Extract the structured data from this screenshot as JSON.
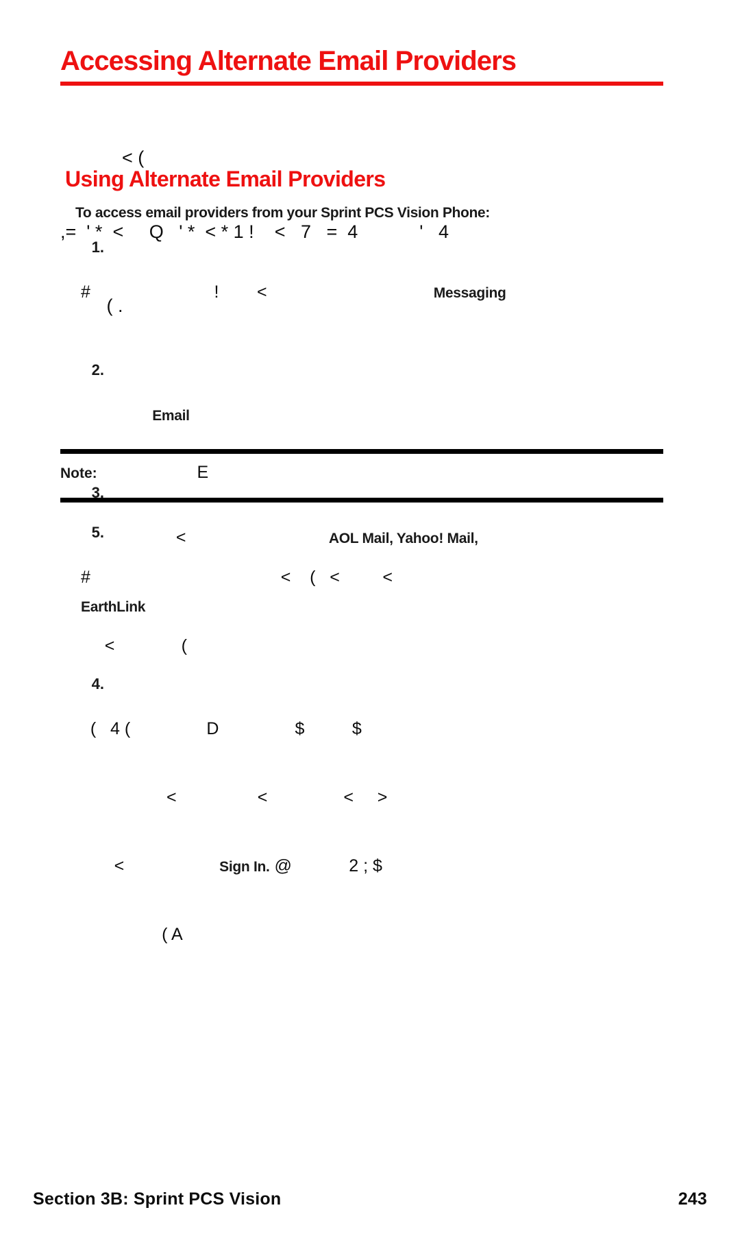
{
  "document": {
    "title": "Accessing Alternate Email Providers",
    "accent_color": "#ee1111",
    "text_color": "#0d0d0d",
    "page_background": "#ffffff"
  },
  "intro_paragraph": {
    "line1": "            < (",
    "line2": ",=  ' *  <     Q   ' *  < * 1 !    <   7   =  4            '   4",
    "line3": "         ( ."
  },
  "subheading": "Using Alternate Email Providers",
  "lead_in": "To access email providers from your Sprint PCS Vision Phone:",
  "steps": [
    {
      "number": "1.",
      "lines": [
        {
          "garbled_before": "#                          !        <                                   ",
          "bold": "Messaging",
          "garbled_after": ""
        }
      ]
    },
    {
      "number": "2.",
      "lines": [
        {
          "garbled_before": "               ",
          "bold": "Email",
          "garbled_after": ""
        }
      ]
    },
    {
      "number": "3.",
      "lines": [
        {
          "garbled_before": "                    <                              ",
          "bold": "AOL Mail, Yahoo! Mail,",
          "garbled_after": ""
        },
        {
          "garbled_before": "",
          "bold": "EarthLink",
          "garbled_after": ""
        }
      ]
    },
    {
      "number": "4.",
      "lines": [
        {
          "garbled_before": "  (   4 (                D                $          $",
          "bold": "",
          "garbled_after": ""
        },
        {
          "garbled_before": "                  <                 <                <     >",
          "bold": "",
          "garbled_after": ""
        },
        {
          "garbled_before": "       <                    ",
          "bold": "Sign In.",
          "garbled_after": " @            2 ; $"
        },
        {
          "garbled_before": "                 ( A",
          "bold": "",
          "garbled_after": ""
        }
      ]
    }
  ],
  "note": {
    "label": "Note:",
    "text": "                     E"
  },
  "steps_tail": [
    {
      "number": "5.",
      "lines": [
        {
          "garbled_before": "#                                        <    (   <         <",
          "bold": "",
          "garbled_after": ""
        },
        {
          "garbled_before": "     <              (",
          "bold": "",
          "garbled_after": ""
        }
      ]
    }
  ],
  "footer": {
    "section": "Section 3B: Sprint PCS Vision",
    "page_number": "243"
  }
}
